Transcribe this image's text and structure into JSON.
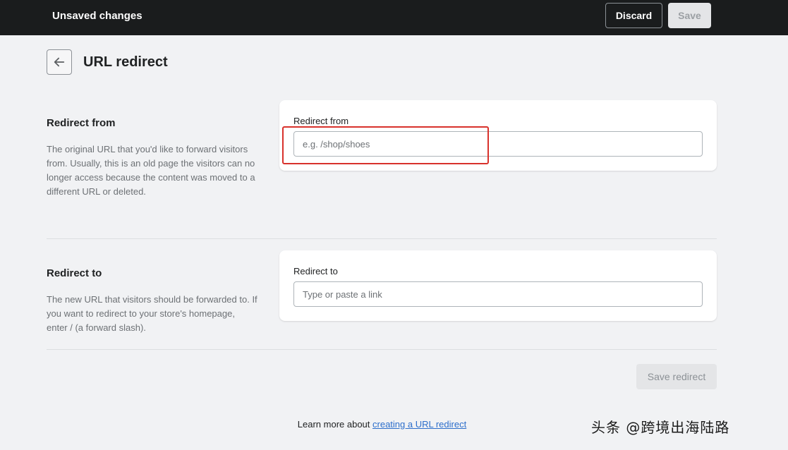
{
  "topbar": {
    "title": "Unsaved changes",
    "discard_label": "Discard",
    "save_label": "Save"
  },
  "header": {
    "back_icon": "arrow-left-icon",
    "title": "URL redirect"
  },
  "redirect_from": {
    "heading": "Redirect from",
    "description": "The original URL that you'd like to forward visitors from. Usually, this is an old page the visitors can no longer access because the content was moved to a different URL or deleted.",
    "field_label": "Redirect from",
    "placeholder": "e.g. /shop/shoes",
    "value": ""
  },
  "redirect_to": {
    "heading": "Redirect to",
    "description": "The new URL that visitors should be forwarded to. If you want to redirect to your store's homepage, enter / (a forward slash).",
    "field_label": "Redirect to",
    "placeholder": "Type or paste a link",
    "value": ""
  },
  "actions": {
    "save_redirect_label": "Save redirect"
  },
  "footer": {
    "help_prefix": "Learn more about ",
    "help_link": "creating a URL redirect"
  },
  "byline": "头条 @跨境出海陆路",
  "colors": {
    "topbar_bg": "#1a1c1d",
    "page_bg": "#f1f2f4",
    "link": "#2c6ecb",
    "highlight": "#d8322c"
  }
}
